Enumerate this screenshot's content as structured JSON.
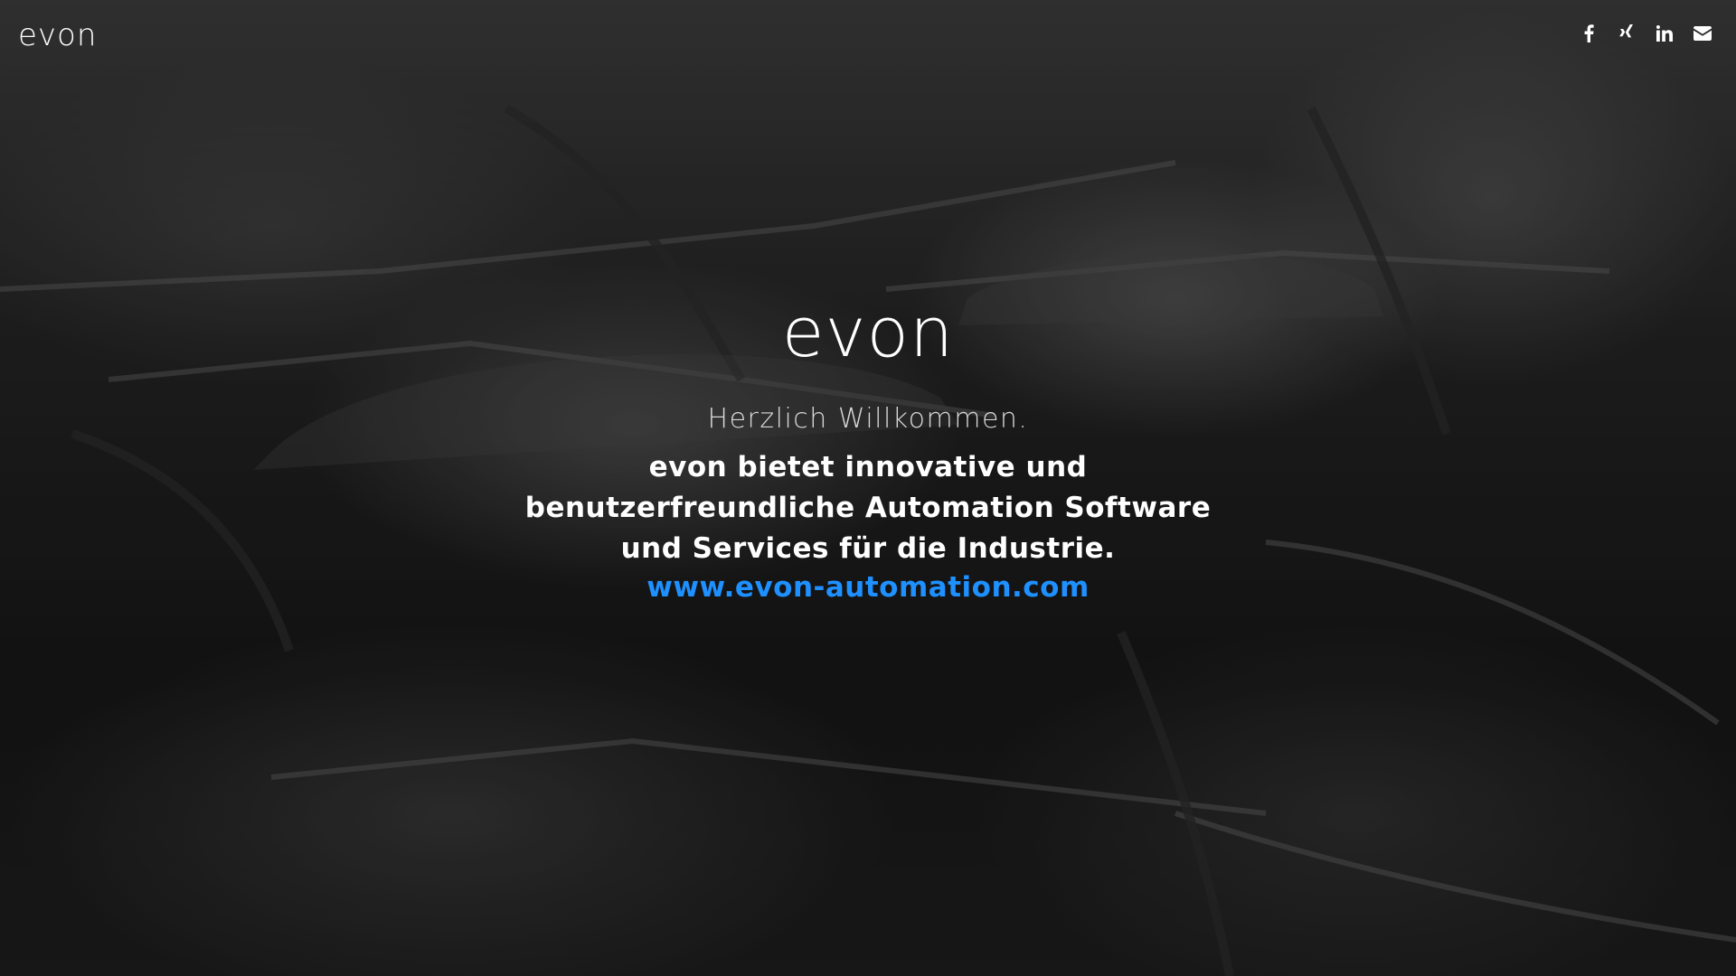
{
  "header": {
    "logo_text": "evon",
    "social": [
      {
        "name": "facebook-icon"
      },
      {
        "name": "xing-icon"
      },
      {
        "name": "linkedin-icon"
      },
      {
        "name": "email-icon"
      }
    ]
  },
  "hero": {
    "brand": "evon",
    "welcome": "Herzlich Willkommen.",
    "tagline": "evon bietet innovative und benutzerfreundliche Automation Software und Services für die Industrie.",
    "link_text": "www.evon-automation.com"
  },
  "colors": {
    "link": "#1e90ff",
    "text": "#ffffff",
    "background": "#161616"
  }
}
